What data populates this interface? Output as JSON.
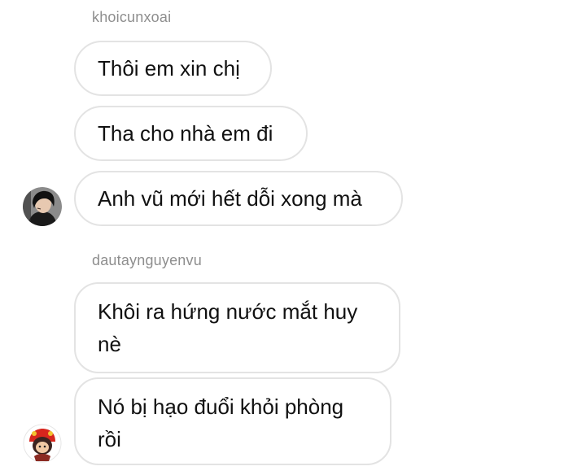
{
  "groups": [
    {
      "sender": "khoicunxoai",
      "messages": [
        "Thôi em xin chị",
        "Tha cho nhà em đi",
        "Anh vũ mới hết dỗi xong mà"
      ]
    },
    {
      "sender": "dautaynguyenvu",
      "messages": [
        {
          "line1": "Khôi ra hứng nước mắt huy",
          "line2": "nè"
        },
        {
          "line1": "Nó bị hạo đuổi khỏi phòng",
          "line2": "rồi"
        }
      ]
    }
  ],
  "colors": {
    "bubble_border": "#e3e3e3",
    "sender_text": "#8e8e8e",
    "message_text": "#111111",
    "background": "#ffffff"
  },
  "icons": {
    "avatar_1": "user-avatar-dark-hair",
    "avatar_2": "user-avatar-cartoon-red"
  }
}
